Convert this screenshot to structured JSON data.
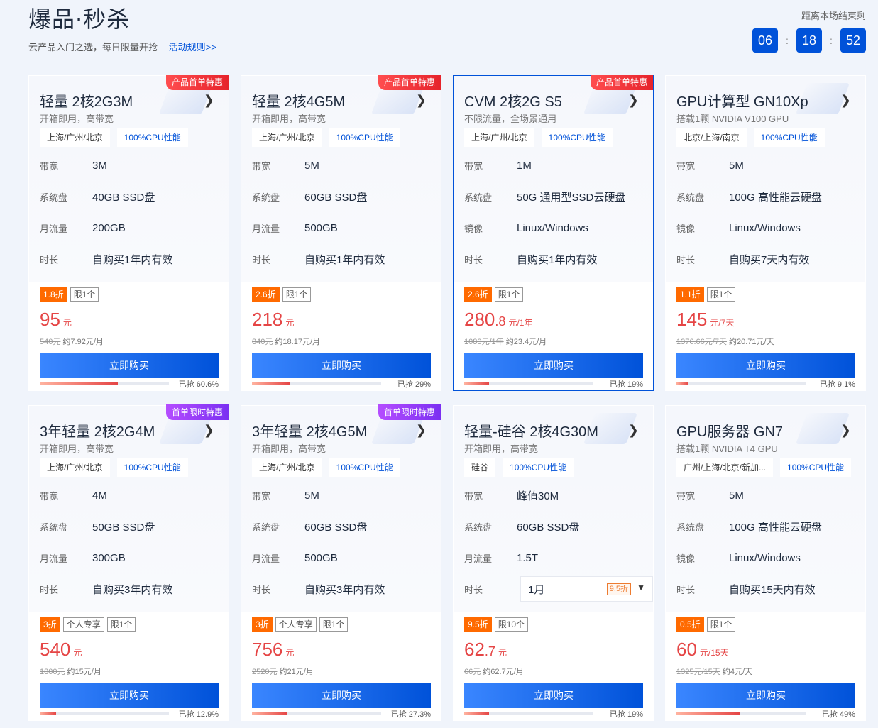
{
  "header": {
    "title": "爆品·秒杀",
    "subtitle": "云产品入门之选，每日限量开抢",
    "rules_link": "活动规则>>",
    "countdown_label": "距离本场结束剩",
    "countdown": {
      "hours": "06",
      "minutes": "18",
      "seconds": "52",
      "separator": ":"
    }
  },
  "colors": {
    "accent": "#0052d9",
    "price": "#e54545",
    "discount": "#ff6a00",
    "badge_red": "#e6232b",
    "badge_purple": "#7b2ff2"
  },
  "icons": {
    "chevron": "chevron-right-icon",
    "caret": "caret-down-icon"
  },
  "buy_label": "立即购买",
  "cards": [
    {
      "badge": "产品首单特惠",
      "badge_color": "red",
      "active": false,
      "name": "轻量 2核2G3M",
      "desc": "开箱即用，高带宽",
      "tags": [
        "上海/广州/北京",
        "100%CPU性能"
      ],
      "specs": [
        {
          "label": "带宽",
          "value": "3M"
        },
        {
          "label": "系统盘",
          "value": "40GB SSD盘"
        },
        {
          "label": "月流量",
          "value": "200GB"
        },
        {
          "label": "时长",
          "value": "自购买1年内有效"
        }
      ],
      "promos": [
        "1.8折",
        "限1个"
      ],
      "price_int": "95",
      "price_dec": "",
      "price_unit": "元",
      "orig_price": "540元",
      "per_month": "约7.92元/月",
      "sold_text": "已抢 60.6%",
      "sold_pct": 60.6
    },
    {
      "badge": "产品首单特惠",
      "badge_color": "red",
      "active": false,
      "name": "轻量 2核4G5M",
      "desc": "开箱即用，高带宽",
      "tags": [
        "上海/广州/北京",
        "100%CPU性能"
      ],
      "specs": [
        {
          "label": "带宽",
          "value": "5M"
        },
        {
          "label": "系统盘",
          "value": "60GB SSD盘"
        },
        {
          "label": "月流量",
          "value": "500GB"
        },
        {
          "label": "时长",
          "value": "自购买1年内有效"
        }
      ],
      "promos": [
        "2.6折",
        "限1个"
      ],
      "price_int": "218",
      "price_dec": "",
      "price_unit": "元",
      "orig_price": "840元",
      "per_month": "约18.17元/月",
      "sold_text": "已抢 29%",
      "sold_pct": 29
    },
    {
      "badge": "产品首单特惠",
      "badge_color": "red",
      "active": true,
      "name": "CVM 2核2G S5",
      "desc": "不限流量，全场景通用",
      "tags": [
        "上海/广州/北京",
        "100%CPU性能"
      ],
      "specs": [
        {
          "label": "带宽",
          "value": "1M"
        },
        {
          "label": "系统盘",
          "value": "50G 通用型SSD云硬盘"
        },
        {
          "label": "镜像",
          "value": "Linux/Windows"
        },
        {
          "label": "时长",
          "value": "自购买1年内有效"
        }
      ],
      "promos": [
        "2.6折",
        "限1个"
      ],
      "price_int": "280",
      "price_dec": ".8",
      "price_unit": "元/1年",
      "orig_price": "1080元/1年",
      "per_month": "约23.4元/月",
      "sold_text": "已抢 19%",
      "sold_pct": 19
    },
    {
      "badge": "",
      "badge_color": "",
      "active": false,
      "name": "GPU计算型 GN10Xp",
      "desc": "搭载1颗 NVIDIA V100 GPU",
      "tags": [
        "北京/上海/南京",
        "100%CPU性能"
      ],
      "specs": [
        {
          "label": "带宽",
          "value": "5M"
        },
        {
          "label": "系统盘",
          "value": "100G 高性能云硬盘"
        },
        {
          "label": "镜像",
          "value": "Linux/Windows"
        },
        {
          "label": "时长",
          "value": "自购买7天内有效"
        }
      ],
      "promos": [
        "1.1折",
        "限1个"
      ],
      "price_int": "145",
      "price_dec": "",
      "price_unit": "元/7天",
      "orig_price": "1376.66元/7天",
      "per_month": "约20.71元/天",
      "sold_text": "已抢 9.1%",
      "sold_pct": 9.1
    },
    {
      "badge": "首单限时特惠",
      "badge_color": "purple",
      "active": false,
      "name": "3年轻量 2核2G4M",
      "desc": "开箱即用，高带宽",
      "tags": [
        "上海/广州/北京",
        "100%CPU性能"
      ],
      "specs": [
        {
          "label": "带宽",
          "value": "4M"
        },
        {
          "label": "系统盘",
          "value": "50GB SSD盘"
        },
        {
          "label": "月流量",
          "value": "300GB"
        },
        {
          "label": "时长",
          "value": "自购买3年内有效"
        }
      ],
      "promos": [
        "3折",
        "个人专享",
        "限1个"
      ],
      "price_int": "540",
      "price_dec": "",
      "price_unit": "元",
      "orig_price": "1800元",
      "per_month": "约15元/月",
      "sold_text": "已抢 12.9%",
      "sold_pct": 12.9
    },
    {
      "badge": "首单限时特惠",
      "badge_color": "purple",
      "active": false,
      "name": "3年轻量 2核4G5M",
      "desc": "开箱即用，高带宽",
      "tags": [
        "上海/广州/北京",
        "100%CPU性能"
      ],
      "specs": [
        {
          "label": "带宽",
          "value": "5M"
        },
        {
          "label": "系统盘",
          "value": "60GB SSD盘"
        },
        {
          "label": "月流量",
          "value": "500GB"
        },
        {
          "label": "时长",
          "value": "自购买3年内有效"
        }
      ],
      "promos": [
        "3折",
        "个人专享",
        "限1个"
      ],
      "price_int": "756",
      "price_dec": "",
      "price_unit": "元",
      "orig_price": "2520元",
      "per_month": "约21元/月",
      "sold_text": "已抢 27.3%",
      "sold_pct": 27.3
    },
    {
      "badge": "",
      "badge_color": "",
      "active": false,
      "name": "轻量-硅谷 2核4G30M",
      "desc": "开箱即用，高带宽",
      "tags": [
        "硅谷",
        "100%CPU性能"
      ],
      "specs": [
        {
          "label": "带宽",
          "value": "峰值30M"
        },
        {
          "label": "系统盘",
          "value": "60GB SSD盘"
        },
        {
          "label": "月流量",
          "value": "1.5T"
        },
        {
          "label": "时长",
          "value": "",
          "select": {
            "value": "1月",
            "discount": "9.5折"
          }
        }
      ],
      "promos": [
        "9.5折",
        "限10个"
      ],
      "price_int": "62",
      "price_dec": ".7",
      "price_unit": "元",
      "orig_price": "66元",
      "per_month": "约62.7元/月",
      "sold_text": "已抢 19%",
      "sold_pct": 19
    },
    {
      "badge": "",
      "badge_color": "",
      "active": false,
      "name": "GPU服务器 GN7",
      "desc": "搭载1颗 NVIDIA T4 GPU",
      "tags": [
        "广州/上海/北京/新加...",
        "100%CPU性能"
      ],
      "specs": [
        {
          "label": "带宽",
          "value": "5M"
        },
        {
          "label": "系统盘",
          "value": "100G 高性能云硬盘"
        },
        {
          "label": "镜像",
          "value": "Linux/Windows"
        },
        {
          "label": "时长",
          "value": "自购买15天内有效"
        }
      ],
      "promos": [
        "0.5折",
        "限1个"
      ],
      "price_int": "60",
      "price_dec": "",
      "price_unit": "元/15天",
      "orig_price": "1325元/15天",
      "per_month": "约4元/天",
      "sold_text": "已抢 49%",
      "sold_pct": 49
    }
  ]
}
